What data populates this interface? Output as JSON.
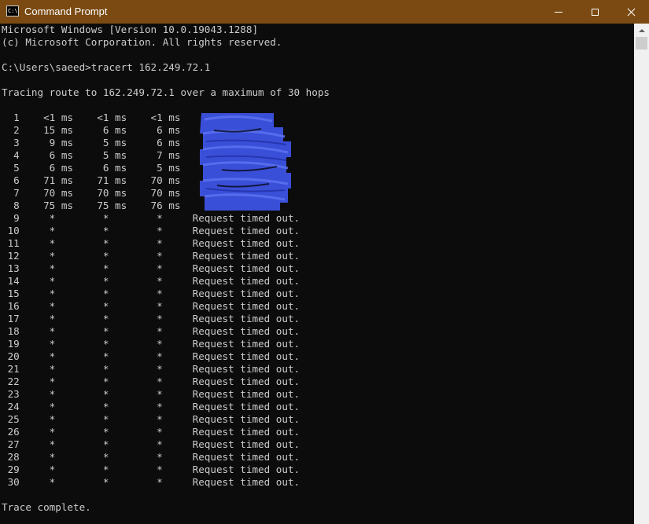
{
  "window": {
    "title": "Command Prompt",
    "icon": "console-icon",
    "icon_text": "C:\\",
    "controls": [
      "minimize-icon",
      "maximize-icon",
      "close-icon"
    ]
  },
  "colors": {
    "titlebar": "#7a4a12",
    "console_bg": "#0c0c0c",
    "console_text": "#cccccc",
    "redaction": "#3a4fd8",
    "scrollbar_track": "#f0f0f0",
    "scrollbar_thumb": "#cdcdcd"
  },
  "console": {
    "lines": [
      "Microsoft Windows [Version 10.0.19043.1288]",
      "(c) Microsoft Corporation. All rights reserved.",
      "",
      "C:\\Users\\saeed>tracert 162.249.72.1",
      "",
      "Tracing route to 162.249.72.1 over a maximum of 30 hops",
      "",
      "  1    <1 ms    <1 ms    <1 ms",
      "  2    15 ms     6 ms     6 ms",
      "  3     9 ms     5 ms     6 ms",
      "  4     6 ms     5 ms     7 ms",
      "  5     6 ms     6 ms     5 ms",
      "  6    71 ms    71 ms    70 ms",
      "  7    70 ms    70 ms    70 ms",
      "  8    75 ms    75 ms    76 ms",
      "  9     *        *        *     Request timed out.",
      " 10     *        *        *     Request timed out.",
      " 11     *        *        *     Request timed out.",
      " 12     *        *        *     Request timed out.",
      " 13     *        *        *     Request timed out.",
      " 14     *        *        *     Request timed out.",
      " 15     *        *        *     Request timed out.",
      " 16     *        *        *     Request timed out.",
      " 17     *        *        *     Request timed out.",
      " 18     *        *        *     Request timed out.",
      " 19     *        *        *     Request timed out.",
      " 20     *        *        *     Request timed out.",
      " 21     *        *        *     Request timed out.",
      " 22     *        *        *     Request timed out.",
      " 23     *        *        *     Request timed out.",
      " 24     *        *        *     Request timed out.",
      " 25     *        *        *     Request timed out.",
      " 26     *        *        *     Request timed out.",
      " 27     *        *        *     Request timed out.",
      " 28     *        *        *     Request timed out.",
      " 29     *        *        *     Request timed out.",
      " 30     *        *        *     Request timed out.",
      "",
      "Trace complete."
    ]
  }
}
